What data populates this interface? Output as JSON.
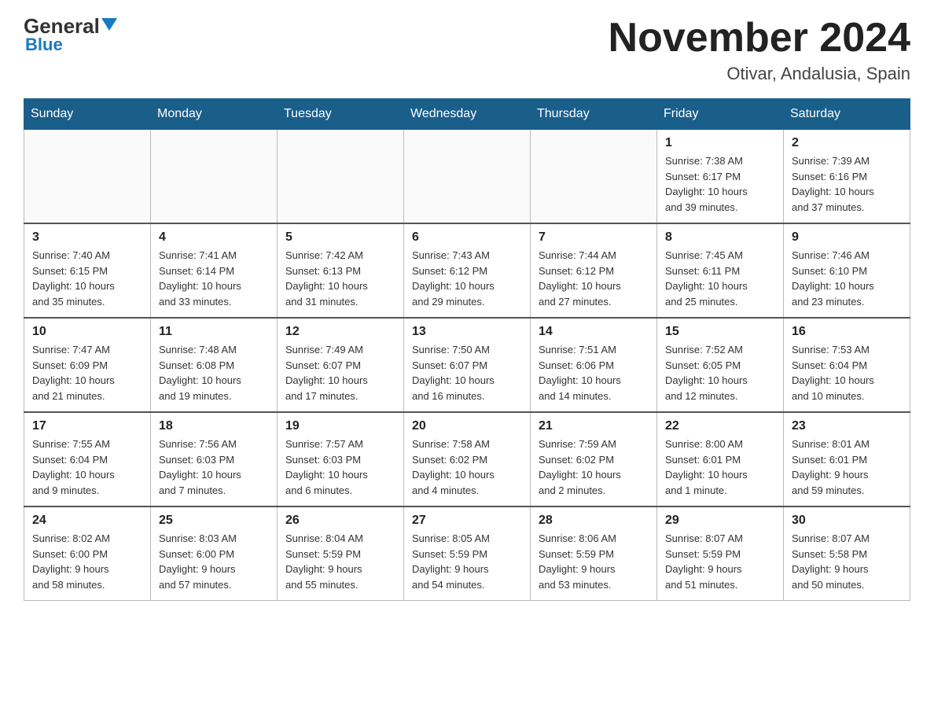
{
  "header": {
    "logo_general": "General",
    "logo_blue": "Blue",
    "month_title": "November 2024",
    "location": "Otivar, Andalusia, Spain"
  },
  "days_of_week": [
    "Sunday",
    "Monday",
    "Tuesday",
    "Wednesday",
    "Thursday",
    "Friday",
    "Saturday"
  ],
  "weeks": [
    [
      {
        "day": "",
        "info": ""
      },
      {
        "day": "",
        "info": ""
      },
      {
        "day": "",
        "info": ""
      },
      {
        "day": "",
        "info": ""
      },
      {
        "day": "",
        "info": ""
      },
      {
        "day": "1",
        "info": "Sunrise: 7:38 AM\nSunset: 6:17 PM\nDaylight: 10 hours\nand 39 minutes."
      },
      {
        "day": "2",
        "info": "Sunrise: 7:39 AM\nSunset: 6:16 PM\nDaylight: 10 hours\nand 37 minutes."
      }
    ],
    [
      {
        "day": "3",
        "info": "Sunrise: 7:40 AM\nSunset: 6:15 PM\nDaylight: 10 hours\nand 35 minutes."
      },
      {
        "day": "4",
        "info": "Sunrise: 7:41 AM\nSunset: 6:14 PM\nDaylight: 10 hours\nand 33 minutes."
      },
      {
        "day": "5",
        "info": "Sunrise: 7:42 AM\nSunset: 6:13 PM\nDaylight: 10 hours\nand 31 minutes."
      },
      {
        "day": "6",
        "info": "Sunrise: 7:43 AM\nSunset: 6:12 PM\nDaylight: 10 hours\nand 29 minutes."
      },
      {
        "day": "7",
        "info": "Sunrise: 7:44 AM\nSunset: 6:12 PM\nDaylight: 10 hours\nand 27 minutes."
      },
      {
        "day": "8",
        "info": "Sunrise: 7:45 AM\nSunset: 6:11 PM\nDaylight: 10 hours\nand 25 minutes."
      },
      {
        "day": "9",
        "info": "Sunrise: 7:46 AM\nSunset: 6:10 PM\nDaylight: 10 hours\nand 23 minutes."
      }
    ],
    [
      {
        "day": "10",
        "info": "Sunrise: 7:47 AM\nSunset: 6:09 PM\nDaylight: 10 hours\nand 21 minutes."
      },
      {
        "day": "11",
        "info": "Sunrise: 7:48 AM\nSunset: 6:08 PM\nDaylight: 10 hours\nand 19 minutes."
      },
      {
        "day": "12",
        "info": "Sunrise: 7:49 AM\nSunset: 6:07 PM\nDaylight: 10 hours\nand 17 minutes."
      },
      {
        "day": "13",
        "info": "Sunrise: 7:50 AM\nSunset: 6:07 PM\nDaylight: 10 hours\nand 16 minutes."
      },
      {
        "day": "14",
        "info": "Sunrise: 7:51 AM\nSunset: 6:06 PM\nDaylight: 10 hours\nand 14 minutes."
      },
      {
        "day": "15",
        "info": "Sunrise: 7:52 AM\nSunset: 6:05 PM\nDaylight: 10 hours\nand 12 minutes."
      },
      {
        "day": "16",
        "info": "Sunrise: 7:53 AM\nSunset: 6:04 PM\nDaylight: 10 hours\nand 10 minutes."
      }
    ],
    [
      {
        "day": "17",
        "info": "Sunrise: 7:55 AM\nSunset: 6:04 PM\nDaylight: 10 hours\nand 9 minutes."
      },
      {
        "day": "18",
        "info": "Sunrise: 7:56 AM\nSunset: 6:03 PM\nDaylight: 10 hours\nand 7 minutes."
      },
      {
        "day": "19",
        "info": "Sunrise: 7:57 AM\nSunset: 6:03 PM\nDaylight: 10 hours\nand 6 minutes."
      },
      {
        "day": "20",
        "info": "Sunrise: 7:58 AM\nSunset: 6:02 PM\nDaylight: 10 hours\nand 4 minutes."
      },
      {
        "day": "21",
        "info": "Sunrise: 7:59 AM\nSunset: 6:02 PM\nDaylight: 10 hours\nand 2 minutes."
      },
      {
        "day": "22",
        "info": "Sunrise: 8:00 AM\nSunset: 6:01 PM\nDaylight: 10 hours\nand 1 minute."
      },
      {
        "day": "23",
        "info": "Sunrise: 8:01 AM\nSunset: 6:01 PM\nDaylight: 9 hours\nand 59 minutes."
      }
    ],
    [
      {
        "day": "24",
        "info": "Sunrise: 8:02 AM\nSunset: 6:00 PM\nDaylight: 9 hours\nand 58 minutes."
      },
      {
        "day": "25",
        "info": "Sunrise: 8:03 AM\nSunset: 6:00 PM\nDaylight: 9 hours\nand 57 minutes."
      },
      {
        "day": "26",
        "info": "Sunrise: 8:04 AM\nSunset: 5:59 PM\nDaylight: 9 hours\nand 55 minutes."
      },
      {
        "day": "27",
        "info": "Sunrise: 8:05 AM\nSunset: 5:59 PM\nDaylight: 9 hours\nand 54 minutes."
      },
      {
        "day": "28",
        "info": "Sunrise: 8:06 AM\nSunset: 5:59 PM\nDaylight: 9 hours\nand 53 minutes."
      },
      {
        "day": "29",
        "info": "Sunrise: 8:07 AM\nSunset: 5:59 PM\nDaylight: 9 hours\nand 51 minutes."
      },
      {
        "day": "30",
        "info": "Sunrise: 8:07 AM\nSunset: 5:58 PM\nDaylight: 9 hours\nand 50 minutes."
      }
    ]
  ]
}
